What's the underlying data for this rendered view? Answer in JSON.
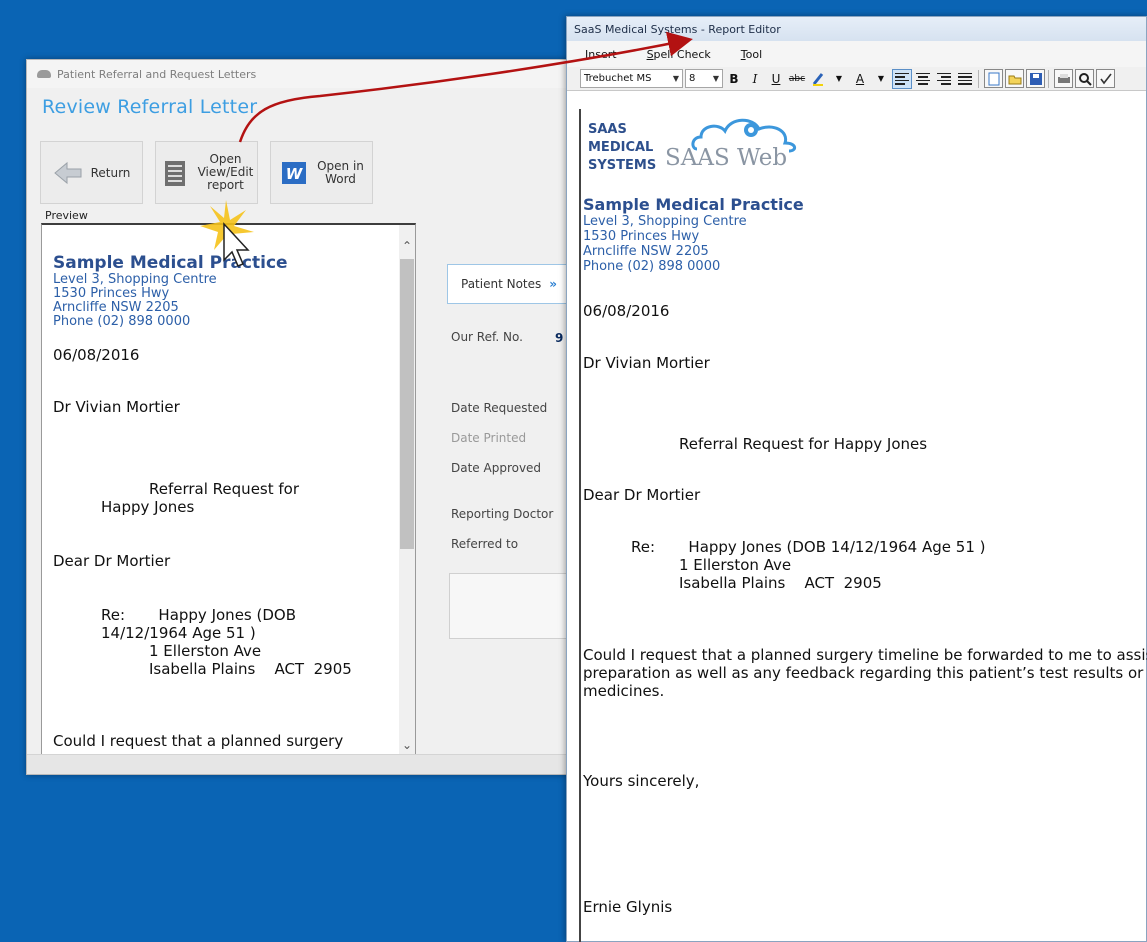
{
  "left_window": {
    "title": "Patient Referral and Request Letters",
    "heading": "Review Referral Letter",
    "buttons": {
      "return": "Return",
      "open_edit": "Open\nView/Edit\nreport",
      "open_word": "Open in\nWord"
    },
    "preview_label": "Preview",
    "preview": {
      "practice": "Sample Medical Practice",
      "addr1": "Level 3, Shopping Centre",
      "addr2": "1530 Princes Hwy",
      "addr3": "Arncliffe NSW 2205",
      "phone": "Phone (02) 898 0000",
      "date": "06/08/2016",
      "doctor": "Dr Vivian Mortier",
      "subject": "Referral Request for Happy Jones",
      "salutation": "Dear Dr Mortier",
      "re_label": "Re:",
      "re_name": "Happy Jones (DOB 14/12/1964 Age 51 )",
      "re_addr1": "1 Ellerston Ave",
      "re_addr2": "Isabella Plains    ACT  2905",
      "body": "Could I request that a planned surgery"
    },
    "patient_notes": "Patient Notes",
    "fields": {
      "our_ref": "Our Ref. No.",
      "our_ref_value": "9",
      "date_requested": "Date Requested",
      "date_printed": "Date Printed",
      "date_approved": "Date Approved",
      "reporting_doctor": "Reporting Doctor",
      "referred_to": "Referred to"
    }
  },
  "right_window": {
    "title": "SaaS Medical Systems - Report Editor",
    "menu": [
      "Insert",
      "Spell Check",
      "Tool"
    ],
    "toolbar": {
      "font": "Trebuchet MS",
      "size": "8",
      "bold": "B",
      "italic": "I",
      "underline": "U",
      "strike": "abc",
      "font_color": "A"
    },
    "logo": {
      "line1": "SAAS",
      "line2": "MEDICAL",
      "line3": "SYSTEMS",
      "web": "SAAS Web"
    },
    "doc": {
      "practice": "Sample Medical Practice",
      "addr1": "Level 3, Shopping Centre",
      "addr2": "1530 Princes Hwy",
      "addr3": "Arncliffe NSW 2205",
      "phone": "Phone (02) 898 0000",
      "date": "06/08/2016",
      "doctor": "Dr Vivian Mortier",
      "subject": "Referral Request for Happy Jones",
      "salutation": "Dear Dr Mortier",
      "re_label": "Re:",
      "re_name": "Happy Jones (DOB 14/12/1964 Age 51 )",
      "re_addr1": "1 Ellerston Ave",
      "re_addr2": "Isabella Plains    ACT  2905",
      "body1": "Could I request that a planned surgery timeline be forwarded to me to assist",
      "body2": "preparation as well as any feedback regarding this patient’s test results or cu",
      "body3": "medicines.",
      "closing": "Yours sincerely,",
      "signature": "Ernie Glynis"
    }
  },
  "colors": {
    "desktop": "#0a64b4",
    "heading": "#3d9ee2",
    "practice": "#2c4f8f",
    "arrow": "#b31212"
  }
}
